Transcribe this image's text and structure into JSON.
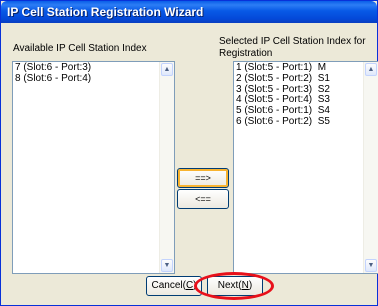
{
  "window": {
    "title": "IP Cell Station Registration Wizard"
  },
  "left_panel": {
    "label": "Available IP Cell Station Index",
    "items": [
      "7 (Slot:6 - Port:3)",
      "8 (Slot:6 - Port:4)"
    ]
  },
  "right_panel": {
    "label_line1": "Selected IP Cell Station Index for",
    "label_line2": "Registration",
    "items": [
      "1 (Slot:5 - Port:1)  M",
      "2 (Slot:5 - Port:2)  S1",
      "3 (Slot:5 - Port:3)  S2",
      "4 (Slot:5 - Port:4)  S3",
      "5 (Slot:6 - Port:1)  S4",
      "6 (Slot:6 - Port:2)  S5"
    ]
  },
  "buttons": {
    "add_label": "==>",
    "remove_label": "<==",
    "cancel_label": "Cancel(",
    "cancel_key": "C",
    "cancel_end": ")",
    "next_label": "Next(",
    "next_key": "N",
    "next_end": ")"
  },
  "icons": {
    "scroll_up": "▲",
    "scroll_down": "▼"
  },
  "colors": {
    "title_bar": "#0a5ee8",
    "highlight_ring": "#e8101a",
    "focus_ring": "#f8b330"
  }
}
